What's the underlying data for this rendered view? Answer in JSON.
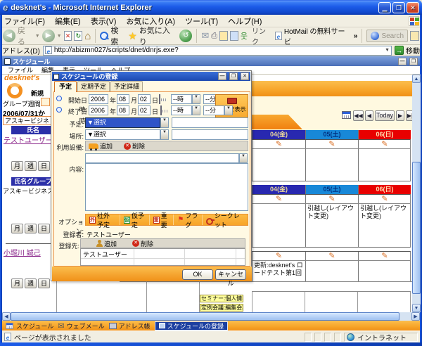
{
  "window": {
    "title": "desknet's - Microsoft Internet Explorer"
  },
  "ie_menu": {
    "items": [
      "ファイル(F)",
      "編集(E)",
      "表示(V)",
      "お気に入り(A)",
      "ツール(T)",
      "ヘルプ(H)"
    ]
  },
  "toolbar": {
    "back": "戻る",
    "search": "検索",
    "favorites": "お気に入り",
    "links": "リンク",
    "hotmail": "HotMail の無料サービ",
    "search_box": "Search"
  },
  "address": {
    "label": "アドレス(D)",
    "url": "http://abizmn027/scripts/dnet/dnrjs.exe?",
    "go": "移動"
  },
  "app": {
    "title": "スケジュール",
    "menu": [
      "ファイル",
      "編集",
      "表示",
      "ツール",
      "ヘルプ"
    ],
    "brand": "desknet's",
    "new_button": "新規",
    "sidebar": {
      "view": "グループ週間",
      "date_from": "2006/07/31か",
      "group_combo": "アスキービジネ",
      "name_header": "氏名",
      "user": "テストユーザー",
      "days": [
        "月",
        "週",
        "日"
      ],
      "group_header": "氏名グループ",
      "group_value": "アスキービジネス..",
      "member": "小堀川 誠己"
    },
    "nav": {
      "today": "Today"
    },
    "grid": {
      "headers": [
        "04(金)",
        "05(土)",
        "06(日)"
      ],
      "event_sat": "引越し(レイアウト変更)",
      "event_sun": "引越し(レイアウト変更)",
      "event_fri": "更新:desknet's ロードテスト第1回",
      "bottom_events": [
        "セミナー:個人情報",
        "定例会議:編集会議"
      ]
    },
    "tabs": [
      "スケジュール",
      "ウェブメール",
      "アドレス帳",
      "スケジュールの登録"
    ]
  },
  "dialog": {
    "title": "スケジュールの登録",
    "tabs": [
      "予定",
      "定期予定",
      "予定詳細"
    ],
    "start_label": "開始日時:",
    "end_label": "終了日時:",
    "year": "2006",
    "year_u": "年",
    "month": "08",
    "month_u": "月",
    "day": "02",
    "day_u": "日",
    "hour": "--時",
    "minute": "--分",
    "band_button": "帯状で表示",
    "subject_label": "予定:",
    "place_label": "場所:",
    "select": "▼選択",
    "facility_label": "利用設備:",
    "add": "追加",
    "remove": "削除",
    "content_label": "内容:",
    "option_label": "オプション:",
    "options": [
      {
        "badge": "外",
        "label": "社外予定"
      },
      {
        "badge": "仮",
        "label": "仮予定"
      },
      {
        "badge": "重",
        "label": "重要"
      },
      {
        "badge": "",
        "label": "フラグ"
      },
      {
        "badge": "",
        "label": "シークレット"
      }
    ],
    "registrant_label": "登録者:",
    "registrant": "テストユーザー",
    "dest_label": "登録先:",
    "dest_user": "テストユーザー",
    "ok": "OK",
    "cancel": "キャンセル"
  },
  "status": {
    "text": "ページが表示されました",
    "zone": "イントラネット"
  },
  "colors": {
    "accent_orange": "#F7A428",
    "titlebar_blue": "#1C5BE8",
    "weekday_header": "#2828B0",
    "saturday_header": "#1888D8",
    "sunday_header": "#E80000",
    "link_purple": "#882288"
  }
}
